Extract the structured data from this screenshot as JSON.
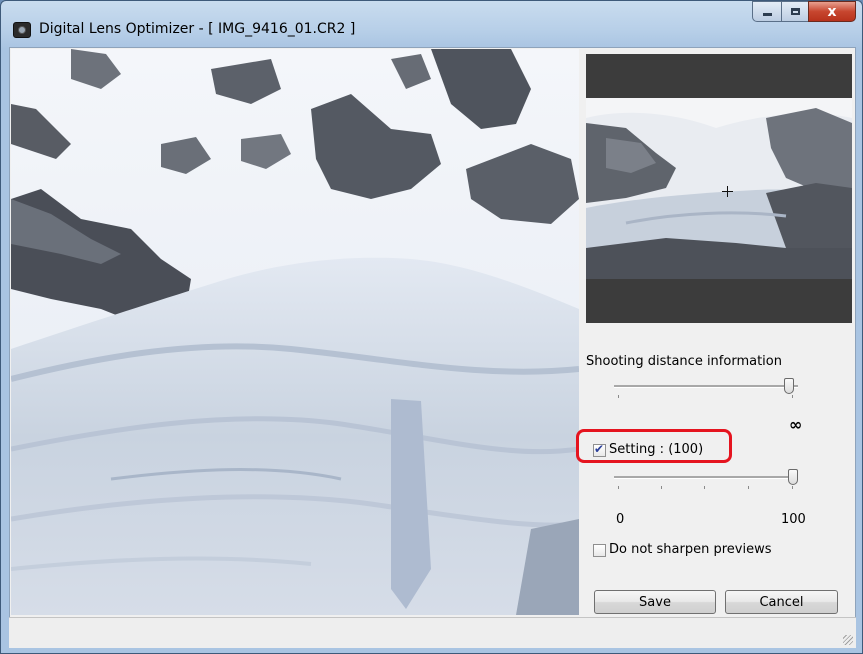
{
  "window": {
    "app_name": "Digital Lens Optimizer",
    "separator": " - ",
    "file": "[ IMG_9416_01.CR2 ]",
    "close_glyph": "x"
  },
  "panel": {
    "shooting_distance_label": "Shooting distance information",
    "infinity_symbol": "∞",
    "setting_label": "Setting : (100)",
    "setting_checked": true,
    "setting_value": 100,
    "setting_min_label": "0",
    "setting_max_label": "100",
    "no_sharpen_label": "Do not sharpen previews",
    "no_sharpen_checked": false,
    "save_label": "Save",
    "cancel_label": "Cancel"
  },
  "colors": {
    "highlight": "#e5141f",
    "navigator_bg": "#3c3c3c",
    "window_frame": "#b7cfe8"
  }
}
